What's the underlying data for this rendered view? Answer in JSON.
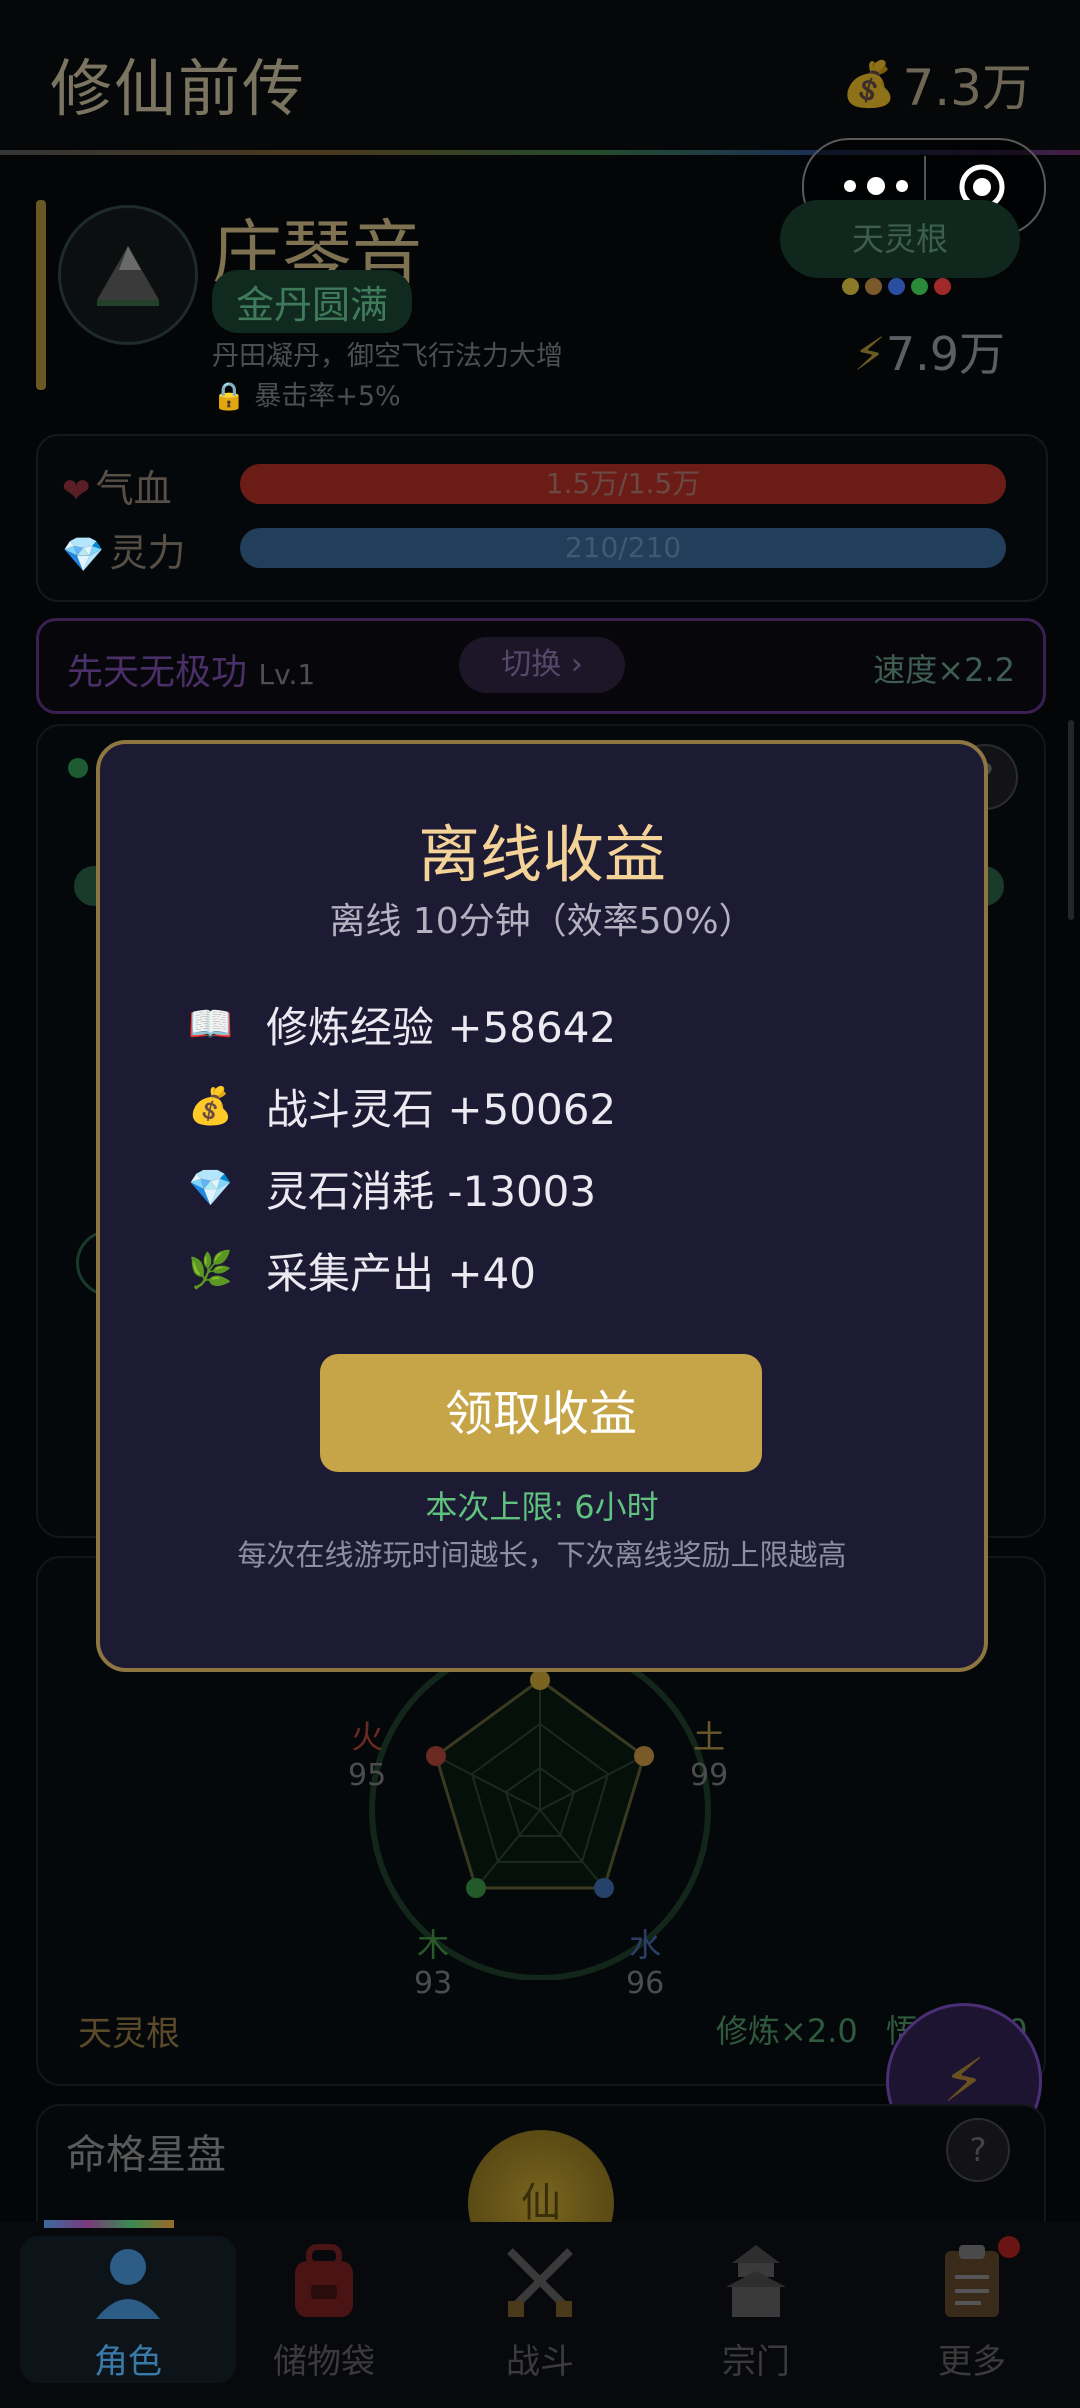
{
  "header": {
    "title": "修仙前传",
    "wealth": "7.3万"
  },
  "character": {
    "name": "庄琴音",
    "realm": "金丹圆满",
    "realm_desc": "丹田凝丹，御空飞行法力大增",
    "crit_bonus": "暴击率+5%",
    "spirit_root": "天灵根",
    "combat_power": "7.9万",
    "element_colors": [
      "#8a7a2a",
      "#7a5a2a",
      "#2a4ea0",
      "#2a8a3a",
      "#a02a2a"
    ]
  },
  "stats": {
    "hp": {
      "label": "气血",
      "value": "1.5万/1.5万",
      "fraction": 1.0,
      "color": "#6b1c17"
    },
    "mp": {
      "label": "灵力",
      "value": "210/210",
      "fraction": 1.0,
      "color": "#213e5a"
    }
  },
  "technique": {
    "name": "先天无极功",
    "level": "Lv.1",
    "switch_label": "切换 ›",
    "speed": "速度×2.2"
  },
  "radar": {
    "elements": [
      {
        "name": "火",
        "value": "95",
        "color": "#6a2a22"
      },
      {
        "name": "土",
        "value": "99",
        "color": "#6a5a2a"
      },
      {
        "name": "木",
        "value": "93",
        "color": "#2a5a2a"
      },
      {
        "name": "水",
        "value": "96",
        "color": "#2a3e66"
      }
    ],
    "root_label": "天灵根",
    "cultivation": "修炼×2.0",
    "insight": "悟性×2.0"
  },
  "star_chart": {
    "title": "命格星盘",
    "center_label": "仙"
  },
  "offline_modal": {
    "title": "离线收益",
    "subtitle": "离线 10分钟（效率50%）",
    "rows": [
      {
        "icon": "book-icon",
        "glyph": "📖",
        "text": "修炼经验 +58642"
      },
      {
        "icon": "money-bag-icon",
        "glyph": "💰",
        "text": "战斗灵石 +50062"
      },
      {
        "icon": "gem-icon",
        "glyph": "💎",
        "text": "灵石消耗 -13003"
      },
      {
        "icon": "herb-icon",
        "glyph": "🌿",
        "text": "采集产出 +40"
      }
    ],
    "claim_label": "领取收益",
    "limit_text": "本次上限: 6小时",
    "tip_text": "每次在线游玩时间越长，下次离线奖励上限越高"
  },
  "nav": {
    "items": [
      {
        "id": "character",
        "label": "角色",
        "icon": "person-icon",
        "active": true
      },
      {
        "id": "storage",
        "label": "储物袋",
        "icon": "bag-icon",
        "active": false
      },
      {
        "id": "battle",
        "label": "战斗",
        "icon": "crossed-swords-icon",
        "active": false
      },
      {
        "id": "sect",
        "label": "宗门",
        "icon": "pagoda-icon",
        "active": false
      },
      {
        "id": "more",
        "label": "更多",
        "icon": "clipboard-icon",
        "active": false
      }
    ]
  }
}
